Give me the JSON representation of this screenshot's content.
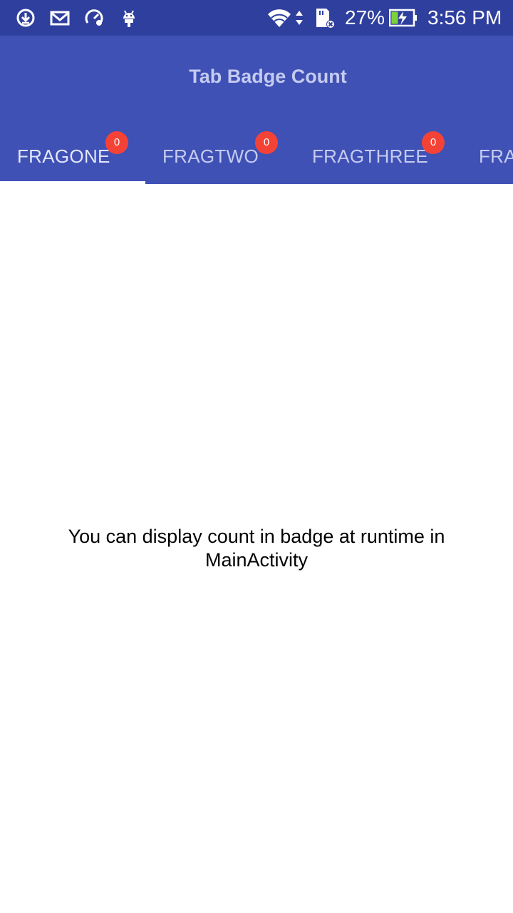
{
  "status_bar": {
    "icons_left": [
      "download-icon",
      "mail-icon",
      "speed-icon",
      "android-icon"
    ],
    "icons_right": [
      "wifi-icon",
      "sd-card-icon",
      "battery-charging-icon"
    ],
    "battery_percent": "27%",
    "time": "3:56 PM",
    "battery_level": 0.27
  },
  "app_bar": {
    "title": "Tab Badge Count"
  },
  "tabs": [
    {
      "label": "FRAGONE",
      "badge": "0",
      "active": true
    },
    {
      "label": "FRAGTWO",
      "badge": "0",
      "active": false
    },
    {
      "label": "FRAGTHREE",
      "badge": "0",
      "active": false
    },
    {
      "label": "FRA",
      "badge": "",
      "active": false
    }
  ],
  "content": {
    "message": "You can display count in badge at runtime in MainActivity"
  },
  "colors": {
    "status_bar": "#2f3f9e",
    "app_bar": "#3f51b5",
    "badge": "#f44336",
    "indicator": "#ffffff"
  }
}
